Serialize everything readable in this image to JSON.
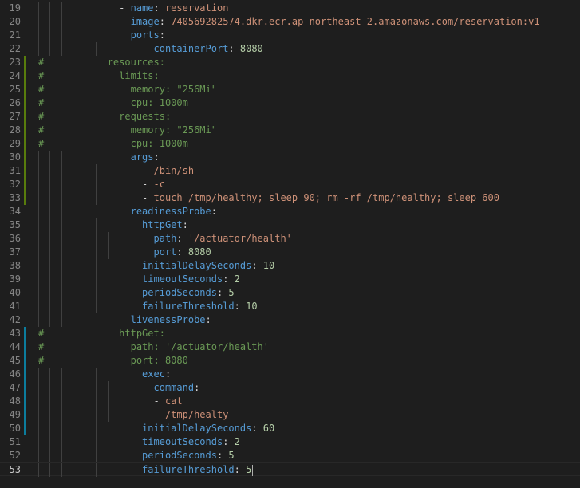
{
  "editor": {
    "language": "yaml",
    "current_line": 53,
    "lines": [
      {
        "num": "19",
        "mark": "",
        "guides": 4,
        "tokens": [
          {
            "t": "              - ",
            "c": "p"
          },
          {
            "t": "name",
            "c": "k"
          },
          {
            "t": ": ",
            "c": "p"
          },
          {
            "t": "reservation",
            "c": "s"
          }
        ]
      },
      {
        "num": "20",
        "mark": "",
        "guides": 5,
        "tokens": [
          {
            "t": "                ",
            "c": "p"
          },
          {
            "t": "image",
            "c": "k"
          },
          {
            "t": ": ",
            "c": "p"
          },
          {
            "t": "740569282574.dkr.ecr.ap-northeast-2.amazonaws.com/reservation:v1",
            "c": "s"
          }
        ]
      },
      {
        "num": "21",
        "mark": "",
        "guides": 5,
        "tokens": [
          {
            "t": "                ",
            "c": "p"
          },
          {
            "t": "ports",
            "c": "k"
          },
          {
            "t": ":",
            "c": "p"
          }
        ]
      },
      {
        "num": "22",
        "mark": "",
        "guides": 6,
        "tokens": [
          {
            "t": "                  - ",
            "c": "p"
          },
          {
            "t": "containerPort",
            "c": "k"
          },
          {
            "t": ": ",
            "c": "p"
          },
          {
            "t": "8080",
            "c": "n"
          }
        ]
      },
      {
        "num": "23",
        "mark": "mod",
        "guides": 0,
        "tokens": [
          {
            "t": "#           resources:",
            "c": "c"
          }
        ]
      },
      {
        "num": "24",
        "mark": "mod",
        "guides": 0,
        "tokens": [
          {
            "t": "#             limits:",
            "c": "c"
          }
        ]
      },
      {
        "num": "25",
        "mark": "mod",
        "guides": 0,
        "tokens": [
          {
            "t": "#               memory: \"256Mi\"",
            "c": "c"
          }
        ]
      },
      {
        "num": "26",
        "mark": "mod",
        "guides": 0,
        "tokens": [
          {
            "t": "#               cpu: 1000m",
            "c": "c"
          }
        ]
      },
      {
        "num": "27",
        "mark": "mod",
        "guides": 0,
        "tokens": [
          {
            "t": "#             requests:",
            "c": "c"
          }
        ]
      },
      {
        "num": "28",
        "mark": "mod",
        "guides": 0,
        "tokens": [
          {
            "t": "#               memory: \"256Mi\"",
            "c": "c"
          }
        ]
      },
      {
        "num": "29",
        "mark": "mod",
        "guides": 0,
        "tokens": [
          {
            "t": "#               cpu: 1000m",
            "c": "c"
          }
        ]
      },
      {
        "num": "30",
        "mark": "mod",
        "guides": 5,
        "tokens": [
          {
            "t": "                ",
            "c": "p"
          },
          {
            "t": "args",
            "c": "k"
          },
          {
            "t": ":",
            "c": "p"
          }
        ]
      },
      {
        "num": "31",
        "mark": "mod",
        "guides": 6,
        "tokens": [
          {
            "t": "                  - ",
            "c": "p"
          },
          {
            "t": "/bin/sh",
            "c": "s"
          }
        ]
      },
      {
        "num": "32",
        "mark": "mod",
        "guides": 6,
        "tokens": [
          {
            "t": "                  - ",
            "c": "p"
          },
          {
            "t": "-c",
            "c": "s"
          }
        ]
      },
      {
        "num": "33",
        "mark": "mod",
        "guides": 6,
        "tokens": [
          {
            "t": "                  - ",
            "c": "p"
          },
          {
            "t": "touch /tmp/healthy; sleep 90; rm -rf /tmp/healthy; sleep 600",
            "c": "s"
          }
        ]
      },
      {
        "num": "34",
        "mark": "",
        "guides": 5,
        "tokens": [
          {
            "t": "                ",
            "c": "p"
          },
          {
            "t": "readinessProbe",
            "c": "k"
          },
          {
            "t": ":",
            "c": "p"
          }
        ]
      },
      {
        "num": "35",
        "mark": "",
        "guides": 6,
        "tokens": [
          {
            "t": "                  ",
            "c": "p"
          },
          {
            "t": "httpGet",
            "c": "k"
          },
          {
            "t": ":",
            "c": "p"
          }
        ]
      },
      {
        "num": "36",
        "mark": "",
        "guides": 7,
        "tokens": [
          {
            "t": "                    ",
            "c": "p"
          },
          {
            "t": "path",
            "c": "k"
          },
          {
            "t": ": ",
            "c": "p"
          },
          {
            "t": "'/actuator/health'",
            "c": "s"
          }
        ]
      },
      {
        "num": "37",
        "mark": "",
        "guides": 7,
        "tokens": [
          {
            "t": "                    ",
            "c": "p"
          },
          {
            "t": "port",
            "c": "k"
          },
          {
            "t": ": ",
            "c": "p"
          },
          {
            "t": "8080",
            "c": "n"
          }
        ]
      },
      {
        "num": "38",
        "mark": "",
        "guides": 6,
        "tokens": [
          {
            "t": "                  ",
            "c": "p"
          },
          {
            "t": "initialDelaySeconds",
            "c": "k"
          },
          {
            "t": ": ",
            "c": "p"
          },
          {
            "t": "10",
            "c": "n"
          }
        ]
      },
      {
        "num": "39",
        "mark": "",
        "guides": 6,
        "tokens": [
          {
            "t": "                  ",
            "c": "p"
          },
          {
            "t": "timeoutSeconds",
            "c": "k"
          },
          {
            "t": ": ",
            "c": "p"
          },
          {
            "t": "2",
            "c": "n"
          }
        ]
      },
      {
        "num": "40",
        "mark": "",
        "guides": 6,
        "tokens": [
          {
            "t": "                  ",
            "c": "p"
          },
          {
            "t": "periodSeconds",
            "c": "k"
          },
          {
            "t": ": ",
            "c": "p"
          },
          {
            "t": "5",
            "c": "n"
          }
        ]
      },
      {
        "num": "41",
        "mark": "",
        "guides": 6,
        "tokens": [
          {
            "t": "                  ",
            "c": "p"
          },
          {
            "t": "failureThreshold",
            "c": "k"
          },
          {
            "t": ": ",
            "c": "p"
          },
          {
            "t": "10",
            "c": "n"
          }
        ]
      },
      {
        "num": "42",
        "mark": "",
        "guides": 5,
        "tokens": [
          {
            "t": "                ",
            "c": "p"
          },
          {
            "t": "livenessProbe",
            "c": "k"
          },
          {
            "t": ":",
            "c": "p"
          }
        ]
      },
      {
        "num": "43",
        "mark": "mod2",
        "guides": 0,
        "tokens": [
          {
            "t": "#             httpGet:",
            "c": "c"
          }
        ]
      },
      {
        "num": "44",
        "mark": "mod2",
        "guides": 0,
        "tokens": [
          {
            "t": "#               path: '/actuator/health'",
            "c": "c"
          }
        ]
      },
      {
        "num": "45",
        "mark": "mod2",
        "guides": 0,
        "tokens": [
          {
            "t": "#               port: 8080",
            "c": "c"
          }
        ]
      },
      {
        "num": "46",
        "mark": "mod2",
        "guides": 6,
        "tokens": [
          {
            "t": "                  ",
            "c": "p"
          },
          {
            "t": "exec",
            "c": "k"
          },
          {
            "t": ":",
            "c": "p"
          }
        ]
      },
      {
        "num": "47",
        "mark": "mod2",
        "guides": 7,
        "tokens": [
          {
            "t": "                    ",
            "c": "p"
          },
          {
            "t": "command",
            "c": "k"
          },
          {
            "t": ":",
            "c": "p"
          }
        ]
      },
      {
        "num": "48",
        "mark": "mod2",
        "guides": 7,
        "tokens": [
          {
            "t": "                    - ",
            "c": "p"
          },
          {
            "t": "cat",
            "c": "s"
          }
        ]
      },
      {
        "num": "49",
        "mark": "mod2",
        "guides": 7,
        "tokens": [
          {
            "t": "                    - ",
            "c": "p"
          },
          {
            "t": "/tmp/healty",
            "c": "s"
          }
        ]
      },
      {
        "num": "50",
        "mark": "mod2",
        "guides": 6,
        "tokens": [
          {
            "t": "                  ",
            "c": "p"
          },
          {
            "t": "initialDelaySeconds",
            "c": "k"
          },
          {
            "t": ": ",
            "c": "p"
          },
          {
            "t": "60",
            "c": "n"
          }
        ]
      },
      {
        "num": "51",
        "mark": "",
        "guides": 6,
        "tokens": [
          {
            "t": "                  ",
            "c": "p"
          },
          {
            "t": "timeoutSeconds",
            "c": "k"
          },
          {
            "t": ": ",
            "c": "p"
          },
          {
            "t": "2",
            "c": "n"
          }
        ]
      },
      {
        "num": "52",
        "mark": "",
        "guides": 6,
        "tokens": [
          {
            "t": "                  ",
            "c": "p"
          },
          {
            "t": "periodSeconds",
            "c": "k"
          },
          {
            "t": ": ",
            "c": "p"
          },
          {
            "t": "5",
            "c": "n"
          }
        ]
      },
      {
        "num": "53",
        "mark": "",
        "guides": 6,
        "tokens": [
          {
            "t": "                  ",
            "c": "p"
          },
          {
            "t": "failureThreshold",
            "c": "k"
          },
          {
            "t": ": ",
            "c": "p"
          },
          {
            "t": "5",
            "c": "n"
          }
        ]
      }
    ]
  },
  "colors": {
    "background": "#1e1e1e",
    "keyword": "#569cd6",
    "string": "#ce9178",
    "number": "#b5cea8",
    "comment": "#6a9955",
    "added_marker": "#587c0c",
    "modified_marker": "#0c7d9d"
  }
}
